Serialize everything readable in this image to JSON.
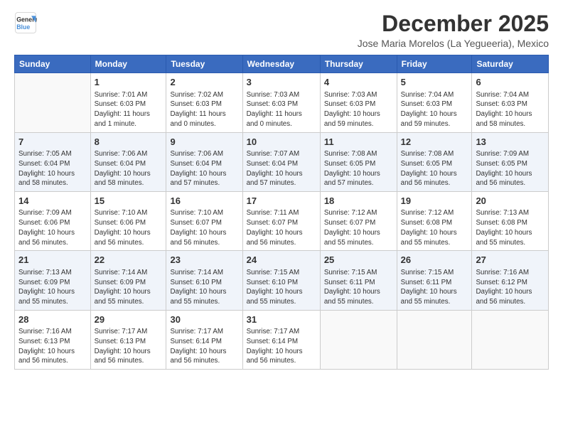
{
  "logo": {
    "line1": "General",
    "line2": "Blue"
  },
  "title": "December 2025",
  "subtitle": "Jose Maria Morelos (La Yegueeria), Mexico",
  "headers": [
    "Sunday",
    "Monday",
    "Tuesday",
    "Wednesday",
    "Thursday",
    "Friday",
    "Saturday"
  ],
  "weeks": [
    {
      "shaded": false,
      "days": [
        {
          "num": "",
          "info": ""
        },
        {
          "num": "1",
          "info": "Sunrise: 7:01 AM\nSunset: 6:03 PM\nDaylight: 11 hours\nand 1 minute."
        },
        {
          "num": "2",
          "info": "Sunrise: 7:02 AM\nSunset: 6:03 PM\nDaylight: 11 hours\nand 0 minutes."
        },
        {
          "num": "3",
          "info": "Sunrise: 7:03 AM\nSunset: 6:03 PM\nDaylight: 11 hours\nand 0 minutes."
        },
        {
          "num": "4",
          "info": "Sunrise: 7:03 AM\nSunset: 6:03 PM\nDaylight: 10 hours\nand 59 minutes."
        },
        {
          "num": "5",
          "info": "Sunrise: 7:04 AM\nSunset: 6:03 PM\nDaylight: 10 hours\nand 59 minutes."
        },
        {
          "num": "6",
          "info": "Sunrise: 7:04 AM\nSunset: 6:03 PM\nDaylight: 10 hours\nand 58 minutes."
        }
      ]
    },
    {
      "shaded": true,
      "days": [
        {
          "num": "7",
          "info": "Sunrise: 7:05 AM\nSunset: 6:04 PM\nDaylight: 10 hours\nand 58 minutes."
        },
        {
          "num": "8",
          "info": "Sunrise: 7:06 AM\nSunset: 6:04 PM\nDaylight: 10 hours\nand 58 minutes."
        },
        {
          "num": "9",
          "info": "Sunrise: 7:06 AM\nSunset: 6:04 PM\nDaylight: 10 hours\nand 57 minutes."
        },
        {
          "num": "10",
          "info": "Sunrise: 7:07 AM\nSunset: 6:04 PM\nDaylight: 10 hours\nand 57 minutes."
        },
        {
          "num": "11",
          "info": "Sunrise: 7:08 AM\nSunset: 6:05 PM\nDaylight: 10 hours\nand 57 minutes."
        },
        {
          "num": "12",
          "info": "Sunrise: 7:08 AM\nSunset: 6:05 PM\nDaylight: 10 hours\nand 56 minutes."
        },
        {
          "num": "13",
          "info": "Sunrise: 7:09 AM\nSunset: 6:05 PM\nDaylight: 10 hours\nand 56 minutes."
        }
      ]
    },
    {
      "shaded": false,
      "days": [
        {
          "num": "14",
          "info": "Sunrise: 7:09 AM\nSunset: 6:06 PM\nDaylight: 10 hours\nand 56 minutes."
        },
        {
          "num": "15",
          "info": "Sunrise: 7:10 AM\nSunset: 6:06 PM\nDaylight: 10 hours\nand 56 minutes."
        },
        {
          "num": "16",
          "info": "Sunrise: 7:10 AM\nSunset: 6:07 PM\nDaylight: 10 hours\nand 56 minutes."
        },
        {
          "num": "17",
          "info": "Sunrise: 7:11 AM\nSunset: 6:07 PM\nDaylight: 10 hours\nand 56 minutes."
        },
        {
          "num": "18",
          "info": "Sunrise: 7:12 AM\nSunset: 6:07 PM\nDaylight: 10 hours\nand 55 minutes."
        },
        {
          "num": "19",
          "info": "Sunrise: 7:12 AM\nSunset: 6:08 PM\nDaylight: 10 hours\nand 55 minutes."
        },
        {
          "num": "20",
          "info": "Sunrise: 7:13 AM\nSunset: 6:08 PM\nDaylight: 10 hours\nand 55 minutes."
        }
      ]
    },
    {
      "shaded": true,
      "days": [
        {
          "num": "21",
          "info": "Sunrise: 7:13 AM\nSunset: 6:09 PM\nDaylight: 10 hours\nand 55 minutes."
        },
        {
          "num": "22",
          "info": "Sunrise: 7:14 AM\nSunset: 6:09 PM\nDaylight: 10 hours\nand 55 minutes."
        },
        {
          "num": "23",
          "info": "Sunrise: 7:14 AM\nSunset: 6:10 PM\nDaylight: 10 hours\nand 55 minutes."
        },
        {
          "num": "24",
          "info": "Sunrise: 7:15 AM\nSunset: 6:10 PM\nDaylight: 10 hours\nand 55 minutes."
        },
        {
          "num": "25",
          "info": "Sunrise: 7:15 AM\nSunset: 6:11 PM\nDaylight: 10 hours\nand 55 minutes."
        },
        {
          "num": "26",
          "info": "Sunrise: 7:15 AM\nSunset: 6:11 PM\nDaylight: 10 hours\nand 55 minutes."
        },
        {
          "num": "27",
          "info": "Sunrise: 7:16 AM\nSunset: 6:12 PM\nDaylight: 10 hours\nand 56 minutes."
        }
      ]
    },
    {
      "shaded": false,
      "days": [
        {
          "num": "28",
          "info": "Sunrise: 7:16 AM\nSunset: 6:13 PM\nDaylight: 10 hours\nand 56 minutes."
        },
        {
          "num": "29",
          "info": "Sunrise: 7:17 AM\nSunset: 6:13 PM\nDaylight: 10 hours\nand 56 minutes."
        },
        {
          "num": "30",
          "info": "Sunrise: 7:17 AM\nSunset: 6:14 PM\nDaylight: 10 hours\nand 56 minutes."
        },
        {
          "num": "31",
          "info": "Sunrise: 7:17 AM\nSunset: 6:14 PM\nDaylight: 10 hours\nand 56 minutes."
        },
        {
          "num": "",
          "info": ""
        },
        {
          "num": "",
          "info": ""
        },
        {
          "num": "",
          "info": ""
        }
      ]
    }
  ]
}
